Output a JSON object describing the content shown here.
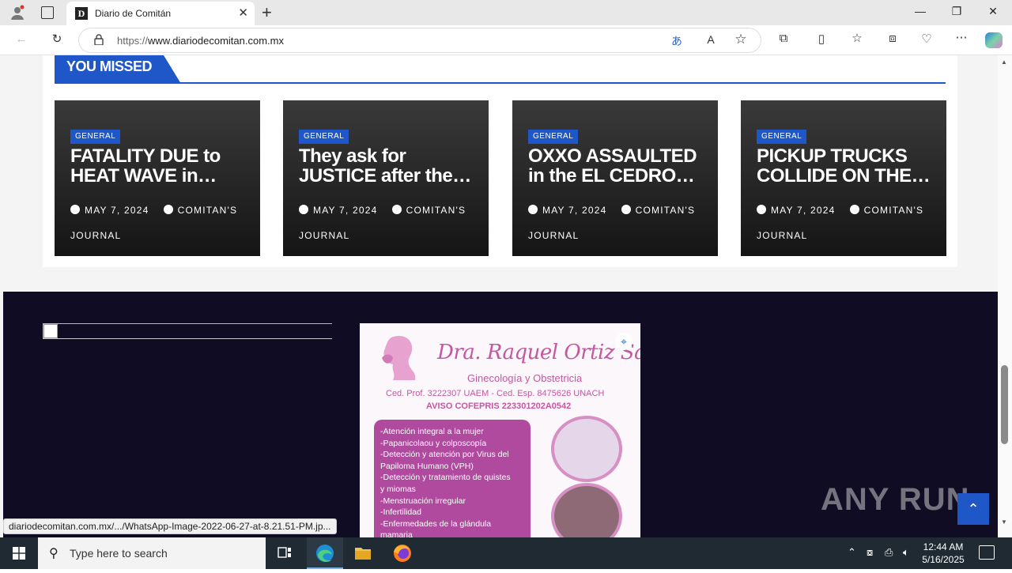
{
  "browser": {
    "tab_title": "Diario de Comitán",
    "tab_favicon": "D",
    "url_proto": "https://",
    "url_host": "www.diariodecomitan.com.mx"
  },
  "section": {
    "heading": "YOU MISSED"
  },
  "cards": [
    {
      "category": "GENERAL",
      "headline": "FATALITY DUE to HEAT WAVE in…",
      "date": "MAY 7, 2024",
      "author": "COMITAN'S JOURNAL"
    },
    {
      "category": "GENERAL",
      "headline": "They ask for JUSTICE after the…",
      "date": "MAY 7, 2024",
      "author": "COMITAN'S JOURNAL"
    },
    {
      "category": "GENERAL",
      "headline": "OXXO ASSAULTED in the EL CEDRO…",
      "date": "MAY 7, 2024",
      "author": "COMITAN'S JOURNAL"
    },
    {
      "category": "GENERAL",
      "headline": "PICKUP TRUCKS COLLIDE ON THE…",
      "date": "MAY 7, 2024",
      "author": "COMITAN'S JOURNAL"
    }
  ],
  "ad": {
    "name": "Dra. Raquel Ortiz Santos",
    "specialty": "Ginecología y Obstetricia",
    "ced": "Ced. Prof. 3222307 UAEM - Ced. Esp. 8475626 UNACH",
    "aviso": "AVISO COFEPRIS 223301202A0542",
    "services": [
      "-Atención integral a la mujer",
      "-Papanicolaou y colposcopía",
      "-Detección y atención por Virus del",
      "  Papiloma Humano (VPH)",
      "-Detección y tratamiento de quistes",
      "  y miomas",
      "-Menstruación irregular",
      "-Infertilidad",
      "-Enfermedades de la glándula",
      "  mamaria"
    ]
  },
  "status_link": "diariodecomitan.com.mx/.../WhatsApp-Image-2022-06-27-at-8.21.51-PM.jp...",
  "watermark": "ANY RUN",
  "taskbar": {
    "search_placeholder": "Type here to search",
    "time": "12:44 AM",
    "date": "5/16/2025"
  },
  "colors": {
    "accent": "#1f57c9",
    "footer_bg": "#0f0c24",
    "ad_pink": "#c457a0"
  }
}
